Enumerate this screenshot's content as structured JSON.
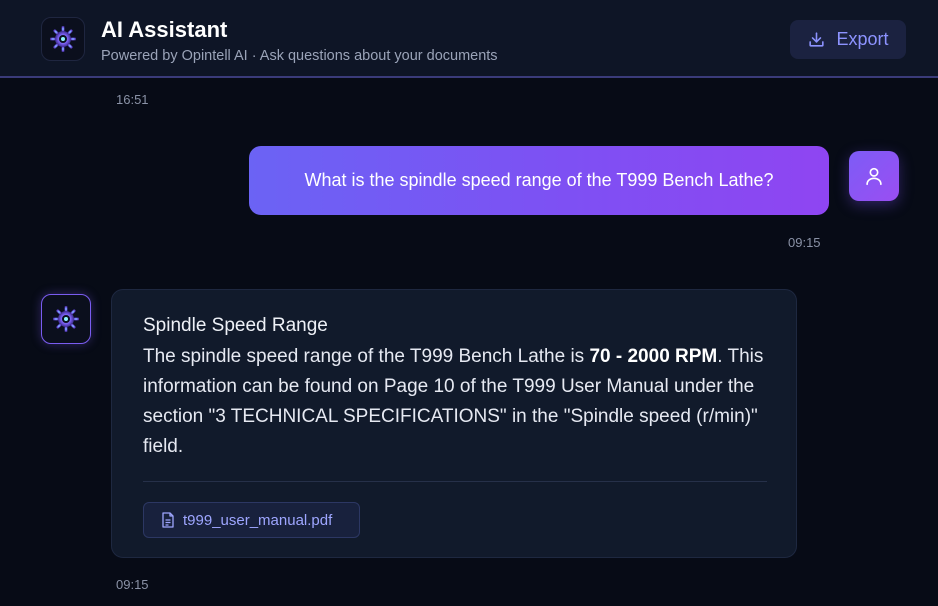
{
  "header": {
    "title": "AI Assistant",
    "subtitle": "Powered by Opintell AI · Ask questions about your documents",
    "export_label": "Export",
    "logo_icon": "gear-brain-icon",
    "export_icon": "download-icon"
  },
  "chat": {
    "top_timestamp": "16:51",
    "messages": [
      {
        "role": "user",
        "text": "What is the spindle speed range of the T999 Bench Lathe?",
        "timestamp": "09:15",
        "avatar_icon": "user-icon"
      },
      {
        "role": "assistant",
        "heading": "Spindle Speed Range",
        "body_before": "The spindle speed range of the T999 Bench Lathe is ",
        "body_bold": "70 - 2000 RPM",
        "body_after": ". This information can be found on Page 10 of the T999 User Manual under the section \"3 TECHNICAL SPECIFICATIONS\" in the \"Spindle speed (r/min)\" field.",
        "source_file": "t999_user_manual.pdf",
        "source_icon": "document-icon",
        "timestamp": "09:15",
        "avatar_icon": "gear-brain-icon"
      }
    ]
  },
  "colors": {
    "background": "#070b16",
    "header_bg": "#0e1526",
    "accent": "#8d93ff",
    "user_bubble_start": "#6b63f4",
    "user_bubble_end": "#8f45f2",
    "card_bg": "#111a2b"
  }
}
